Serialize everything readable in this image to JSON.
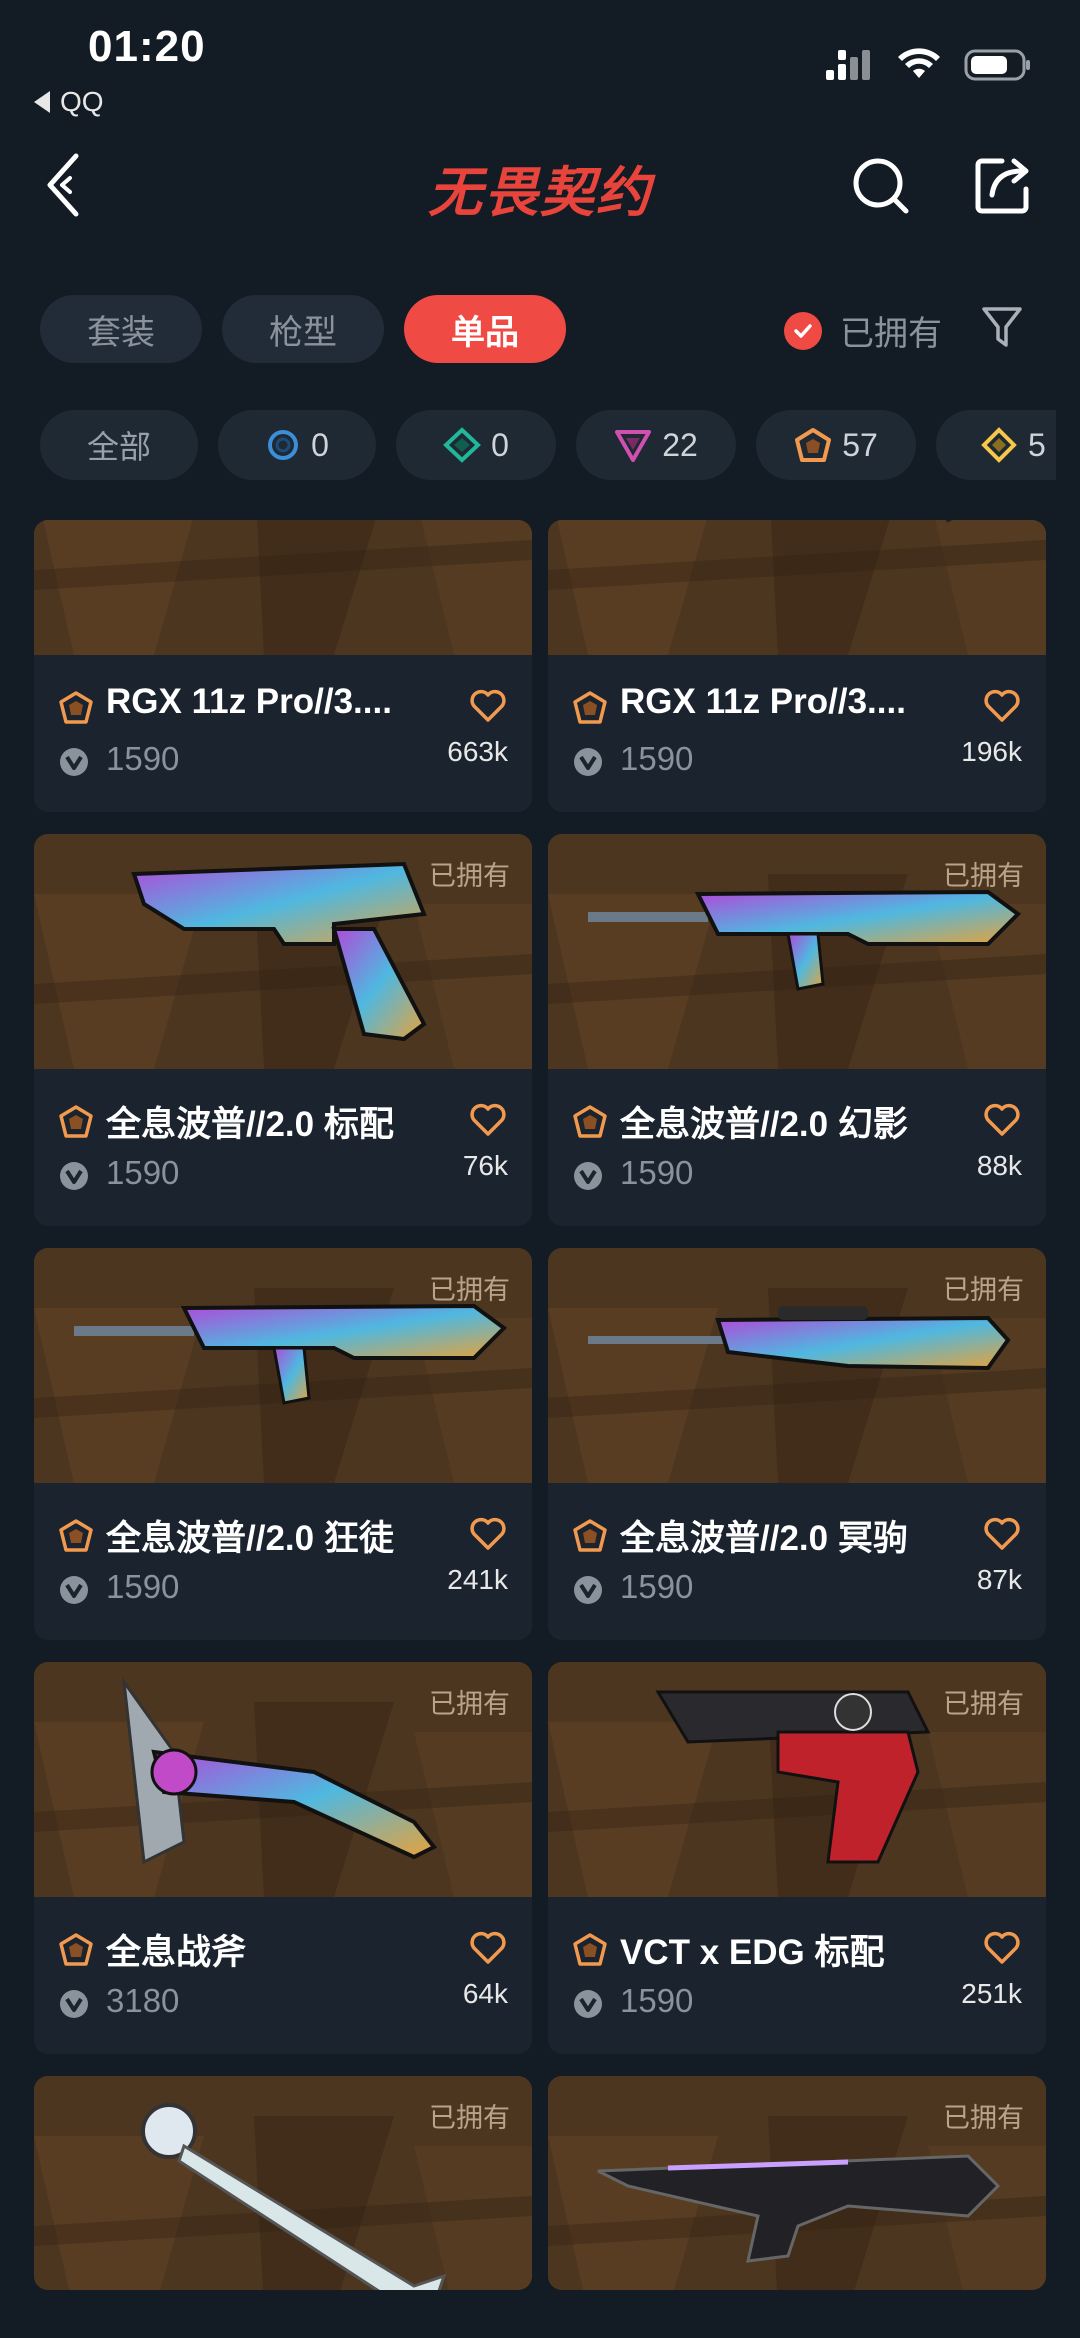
{
  "status_bar": {
    "time": "01:20",
    "back_app": "QQ"
  },
  "header": {
    "title": "无畏契约",
    "back_icon": "back-icon",
    "search_icon": "search-icon",
    "share_icon": "share-icon"
  },
  "tabs": [
    {
      "label": "套装",
      "active": false
    },
    {
      "label": "枪型",
      "active": false
    },
    {
      "label": "单品",
      "active": true
    }
  ],
  "owned_filter": {
    "label": "已拥有",
    "checked": true
  },
  "rarity_chips": [
    {
      "label": "全部",
      "count": ""
    },
    {
      "icon": "select-tier-icon",
      "count": "0",
      "color": "#3a8fd8"
    },
    {
      "icon": "deluxe-tier-icon",
      "count": "0",
      "color": "#1fb89a"
    },
    {
      "icon": "premium-tier-icon",
      "count": "22",
      "color": "#d14fb0"
    },
    {
      "icon": "ultra-tier-icon",
      "count": "57",
      "color": "#f19a4f"
    },
    {
      "icon": "exclusive-tier-icon",
      "count": "5",
      "color": "#f5c84a"
    }
  ],
  "items": [
    {
      "name": "RGX 11z Pro//3....",
      "price": "1590",
      "likes": "663k",
      "owned": "",
      "weapon": "rifle-green"
    },
    {
      "name": "RGX 11z Pro//3....",
      "price": "1590",
      "likes": "196k",
      "owned": "",
      "weapon": "pistol-green"
    },
    {
      "name": "全息波普//2.0 标配",
      "price": "1590",
      "likes": "76k",
      "owned": "已拥有",
      "weapon": "pistol"
    },
    {
      "name": "全息波普//2.0 幻影",
      "price": "1590",
      "likes": "88k",
      "owned": "已拥有",
      "weapon": "rifle"
    },
    {
      "name": "全息波普//2.0 狂徒",
      "price": "1590",
      "likes": "241k",
      "owned": "已拥有",
      "weapon": "rifle"
    },
    {
      "name": "全息波普//2.0 冥驹",
      "price": "1590",
      "likes": "87k",
      "owned": "已拥有",
      "weapon": "sniper"
    },
    {
      "name": "全息战斧",
      "price": "3180",
      "likes": "64k",
      "owned": "已拥有",
      "weapon": "axe"
    },
    {
      "name": "VCT x EDG 标配",
      "price": "1590",
      "likes": "251k",
      "owned": "已拥有",
      "weapon": "pistol-red"
    },
    {
      "name": "",
      "price": "",
      "likes": "",
      "owned": "已拥有",
      "weapon": "staff"
    },
    {
      "name": "",
      "price": "",
      "likes": "",
      "owned": "已拥有",
      "weapon": "smg-dark"
    }
  ],
  "colors": {
    "accent": "#f04a44",
    "ultra": "#f19a4f",
    "background": "#131b25"
  }
}
